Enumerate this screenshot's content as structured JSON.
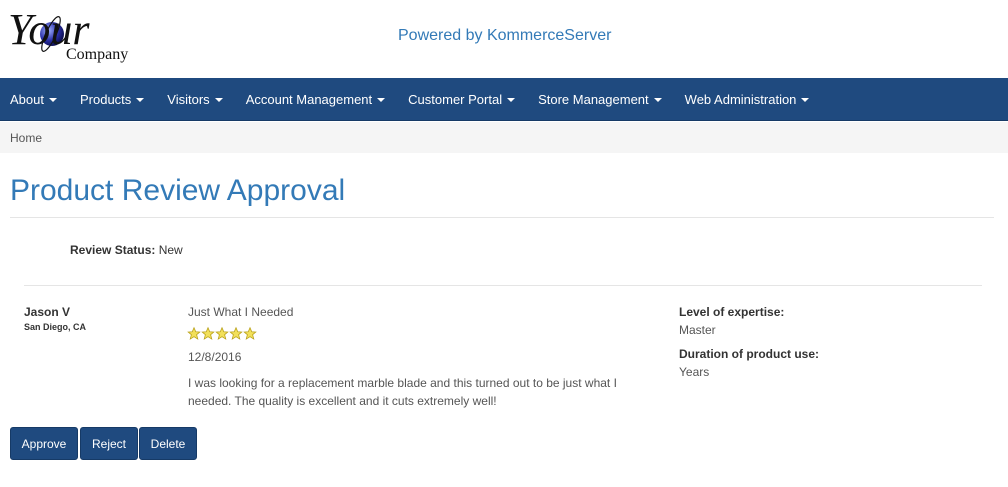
{
  "header": {
    "logo_main": "Your",
    "logo_sub": "Company",
    "powered_by": "Powered by KommerceServer"
  },
  "nav": {
    "items": [
      {
        "label": "About"
      },
      {
        "label": "Products"
      },
      {
        "label": "Visitors"
      },
      {
        "label": "Account Management"
      },
      {
        "label": "Customer Portal"
      },
      {
        "label": "Store Management"
      },
      {
        "label": "Web Administration"
      }
    ]
  },
  "breadcrumb": {
    "home": "Home"
  },
  "page": {
    "title": "Product Review Approval"
  },
  "status": {
    "label": "Review Status:",
    "value": "New"
  },
  "review": {
    "reviewer_name": "Jason V",
    "reviewer_location": "San Diego, CA",
    "title": "Just What I Needed",
    "rating": 5,
    "rating_max": 5,
    "date": "12/8/2016",
    "text": "I was looking for a replacement marble blade and this turned out to be just what I needed. The quality is excellent and it cuts extremely well!",
    "expertise_label": "Level of expertise:",
    "expertise_value": "Master",
    "duration_label": "Duration of product use:",
    "duration_value": "Years"
  },
  "actions": {
    "approve": "Approve",
    "reject": "Reject",
    "delete": "Delete"
  },
  "colors": {
    "navbar": "#1f4a7f",
    "link_blue": "#337ab7",
    "star_fill": "#f2e05a",
    "star_stroke": "#b8a018"
  }
}
